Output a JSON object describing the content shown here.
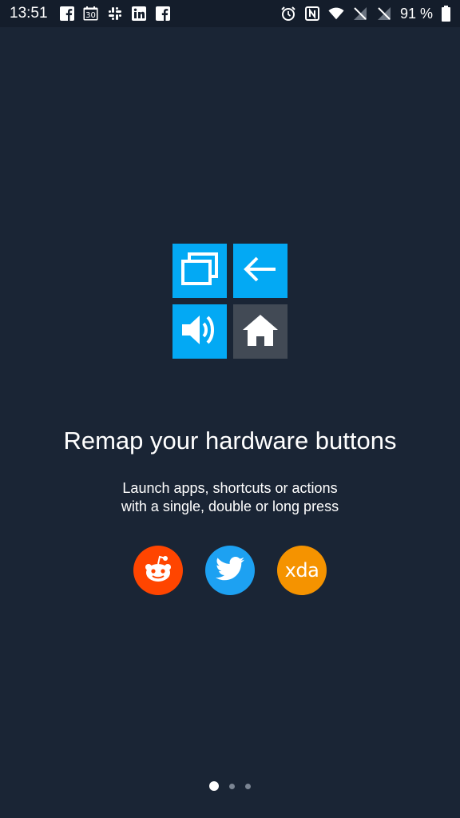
{
  "status_bar": {
    "time": "13:51",
    "battery_percent": "91 %",
    "left_icons": [
      "facebook-icon",
      "calendar-icon",
      "slack-icon",
      "linkedin-icon",
      "facebook-icon"
    ],
    "calendar_day": "30",
    "right_icons": [
      "alarm-icon",
      "nfc-icon",
      "wifi-icon",
      "signal-icon",
      "signal-icon",
      "battery-icon"
    ]
  },
  "hero": {
    "tiles": [
      "recents-icon",
      "back-icon",
      "volume-icon",
      "home-icon"
    ],
    "colors": {
      "accent": "#03a9f4",
      "tile_gray": "#424a55",
      "background": "#1a2535"
    }
  },
  "headline": "Remap your hardware buttons",
  "subtext": {
    "line1": "Launch apps, shortcuts or actions",
    "line2": "with a single, double or long press"
  },
  "social": {
    "reddit": {
      "icon": "reddit-icon",
      "color": "#ff4500"
    },
    "twitter": {
      "icon": "twitter-icon",
      "color": "#1da1f2"
    },
    "xda": {
      "label": "xda",
      "color": "#f59300"
    }
  },
  "pager": {
    "pages": 3,
    "active": 1
  }
}
